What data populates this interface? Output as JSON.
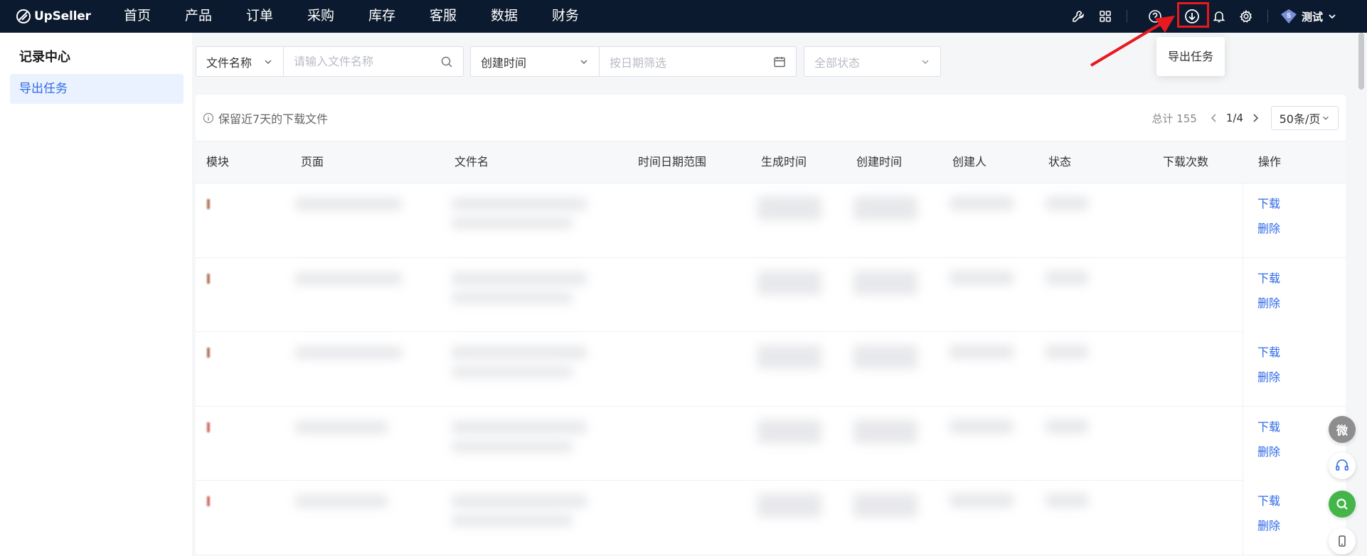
{
  "app": {
    "logo_text": "UpSeller"
  },
  "nav": {
    "items": [
      "首页",
      "产品",
      "订单",
      "采购",
      "库存",
      "客服",
      "数据",
      "财务"
    ]
  },
  "topbar": {
    "user_name": "测试",
    "user_badge": "S",
    "icons": [
      "wrench-icon",
      "apps-grid-icon",
      "help-circle-icon",
      "download-icon",
      "bell-icon",
      "settings-gear-icon"
    ],
    "highlight_color": "#e8191f"
  },
  "tooltip": {
    "text": "导出任务"
  },
  "sidebar": {
    "title": "记录中心",
    "items": [
      {
        "label": "导出任务",
        "active": true
      }
    ]
  },
  "filters": {
    "field_select": "文件名称",
    "search_placeholder": "请输入文件名称",
    "time_select": "创建时间",
    "date_placeholder": "按日期筛选",
    "status_placeholder": "全部状态"
  },
  "panel": {
    "note": "保留近7天的下载文件",
    "total": "总计 155",
    "page": "1/4",
    "per_page": "50条/页"
  },
  "table": {
    "columns": [
      "模块",
      "页面",
      "文件名",
      "时间日期范围",
      "生成时间",
      "创建时间",
      "创建人",
      "状态",
      "下载次数",
      "操作"
    ],
    "row_actions": {
      "download": "下载",
      "delete": "删除"
    },
    "rows": [
      {
        "download": "下载",
        "delete": "删除"
      },
      {
        "download": "下载",
        "delete": "删除"
      },
      {
        "download": "下载",
        "delete": "删除"
      },
      {
        "download": "下载",
        "delete": "删除"
      },
      {
        "download": "下载",
        "delete": "删除"
      }
    ]
  },
  "float_buttons": [
    {
      "icon": "wechat-icon",
      "label": "微"
    },
    {
      "icon": "headset-icon"
    },
    {
      "icon": "search-icon"
    },
    {
      "icon": "mobile-icon"
    }
  ],
  "colors": {
    "accent": "#2f6ae8",
    "topbar": "#0b1a2e",
    "annotation_red": "#e8191f",
    "float_green": "#44b549"
  }
}
